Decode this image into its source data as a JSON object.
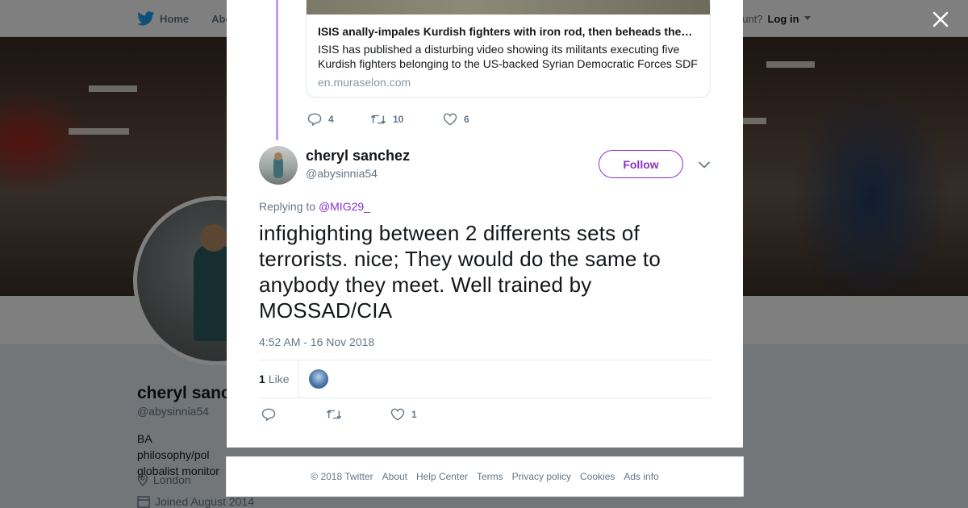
{
  "topbar": {
    "home_label": "Home",
    "about_label": "Abo",
    "account_prompt": "ccount?",
    "login_label": "Log in"
  },
  "profile": {
    "name": "cheryl sanc",
    "handle": "@abysinnia54",
    "bio": "BA philosophy/pol globalist monitor",
    "location": "London",
    "joined": "Joined August 2014"
  },
  "quoted_card": {
    "title": "ISIS anally-impales Kurdish fighters with iron rod, then beheads the…",
    "description": "ISIS has published a disturbing video showing its militants executing five Kurdish fighters belonging to the US-backed Syrian Democratic Forces SDF",
    "domain": "en.muraselon.com"
  },
  "parent_actions": {
    "replies": "4",
    "retweets": "10",
    "likes": "6"
  },
  "tweet": {
    "author_name": "cheryl sanchez",
    "author_handle": "@abysinnia54",
    "follow_label": "Follow",
    "replying_prefix": "Replying to",
    "replying_to": "@MIG29_",
    "text": "infighighting between 2 differents sets of terrorists. nice; They would do the same to anybody they meet. Well trained by MOSSAD/CIA",
    "timestamp": "4:52 AM - 16 Nov 2018",
    "like_count": "1",
    "like_word": "Like",
    "actions": {
      "replies": "",
      "retweets": "",
      "likes": "1"
    }
  },
  "footer": {
    "copyright": "© 2018 Twitter",
    "links": [
      "About",
      "Help Center",
      "Terms",
      "Privacy policy",
      "Cookies",
      "Ads info"
    ]
  },
  "colors": {
    "accent": "#8b2fc9",
    "thread_line": "#c3a0e4",
    "twitter_blue": "#1da1f2",
    "muted_text": "#657786"
  },
  "icons": [
    "twitter-bird-icon",
    "close-icon",
    "reply-icon",
    "retweet-icon",
    "heart-icon",
    "chevron-down-icon",
    "location-icon",
    "calendar-icon"
  ]
}
